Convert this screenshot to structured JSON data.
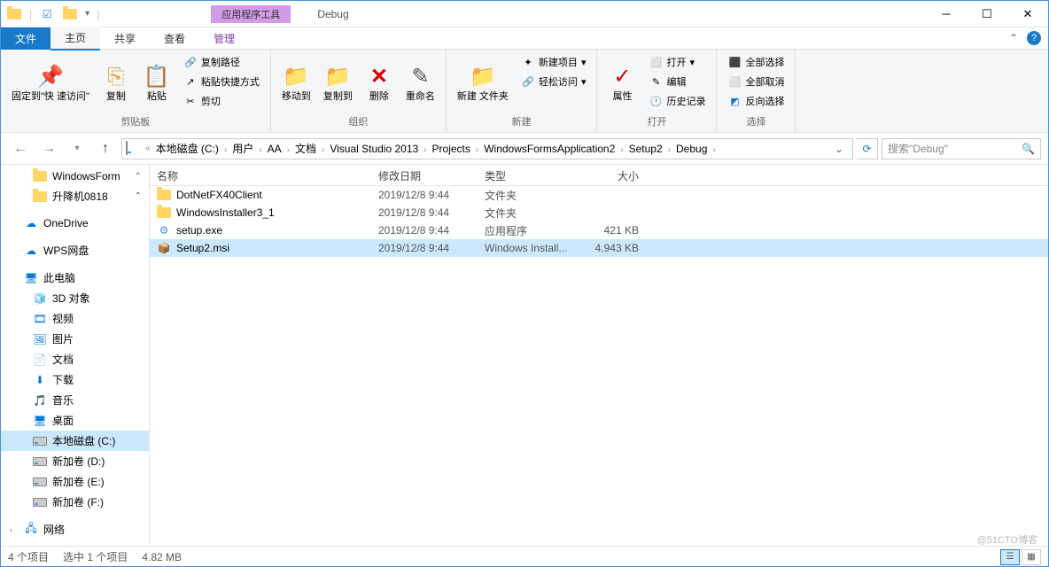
{
  "window": {
    "context_tab": "应用程序工具",
    "title": "Debug"
  },
  "tabs": {
    "file": "文件",
    "home": "主页",
    "share": "共享",
    "view": "查看",
    "manage": "管理"
  },
  "ribbon": {
    "clipboard": {
      "pin": "固定到\"快\n速访问\"",
      "copy": "复制",
      "paste": "粘贴",
      "copy_path": "复制路径",
      "paste_shortcut": "粘贴快捷方式",
      "cut": "剪切",
      "label": "剪贴板"
    },
    "organize": {
      "move_to": "移动到",
      "copy_to": "复制到",
      "delete": "删除",
      "rename": "重命名",
      "label": "组织"
    },
    "new": {
      "new_folder": "新建\n文件夹",
      "new_item": "新建项目",
      "easy_access": "轻松访问",
      "label": "新建"
    },
    "open": {
      "properties": "属性",
      "open": "打开",
      "edit": "编辑",
      "history": "历史记录",
      "label": "打开"
    },
    "select": {
      "select_all": "全部选择",
      "select_none": "全部取消",
      "invert": "反向选择",
      "label": "选择"
    }
  },
  "breadcrumb": {
    "items": [
      "本地磁盘 (C:)",
      "用户",
      "AA",
      "文档",
      "Visual Studio 2013",
      "Projects",
      "WindowsFormsApplication2",
      "Setup2",
      "Debug"
    ]
  },
  "search": {
    "placeholder": "搜索\"Debug\""
  },
  "nav": {
    "quick_access": [
      {
        "name": "WindowsForm",
        "icon": "folder"
      },
      {
        "name": "升降机0818",
        "icon": "folder"
      }
    ],
    "onedrive": "OneDrive",
    "wps": "WPS网盘",
    "this_pc": "此电脑",
    "pc_items": [
      {
        "name": "3D 对象",
        "icon": "3d"
      },
      {
        "name": "视频",
        "icon": "video"
      },
      {
        "name": "图片",
        "icon": "pic"
      },
      {
        "name": "文档",
        "icon": "doc"
      },
      {
        "name": "下载",
        "icon": "dl"
      },
      {
        "name": "音乐",
        "icon": "music"
      },
      {
        "name": "桌面",
        "icon": "desktop"
      },
      {
        "name": "本地磁盘 (C:)",
        "icon": "disk",
        "selected": true
      },
      {
        "name": "新加卷 (D:)",
        "icon": "disk"
      },
      {
        "name": "新加卷 (E:)",
        "icon": "disk"
      },
      {
        "name": "新加卷 (F:)",
        "icon": "disk"
      }
    ],
    "network": "网络"
  },
  "columns": {
    "name": "名称",
    "date": "修改日期",
    "type": "类型",
    "size": "大小"
  },
  "files": [
    {
      "name": "DotNetFX40Client",
      "date": "2019/12/8 9:44",
      "type": "文件夹",
      "size": "",
      "icon": "folder"
    },
    {
      "name": "WindowsInstaller3_1",
      "date": "2019/12/8 9:44",
      "type": "文件夹",
      "size": "",
      "icon": "folder"
    },
    {
      "name": "setup.exe",
      "date": "2019/12/8 9:44",
      "type": "应用程序",
      "size": "421 KB",
      "icon": "exe"
    },
    {
      "name": "Setup2.msi",
      "date": "2019/12/8 9:44",
      "type": "Windows Install...",
      "size": "4,943 KB",
      "icon": "msi",
      "selected": true
    }
  ],
  "status": {
    "count": "4 个项目",
    "selected": "选中 1 个项目",
    "size": "4.82 MB"
  },
  "watermark": "@51CTO博客"
}
